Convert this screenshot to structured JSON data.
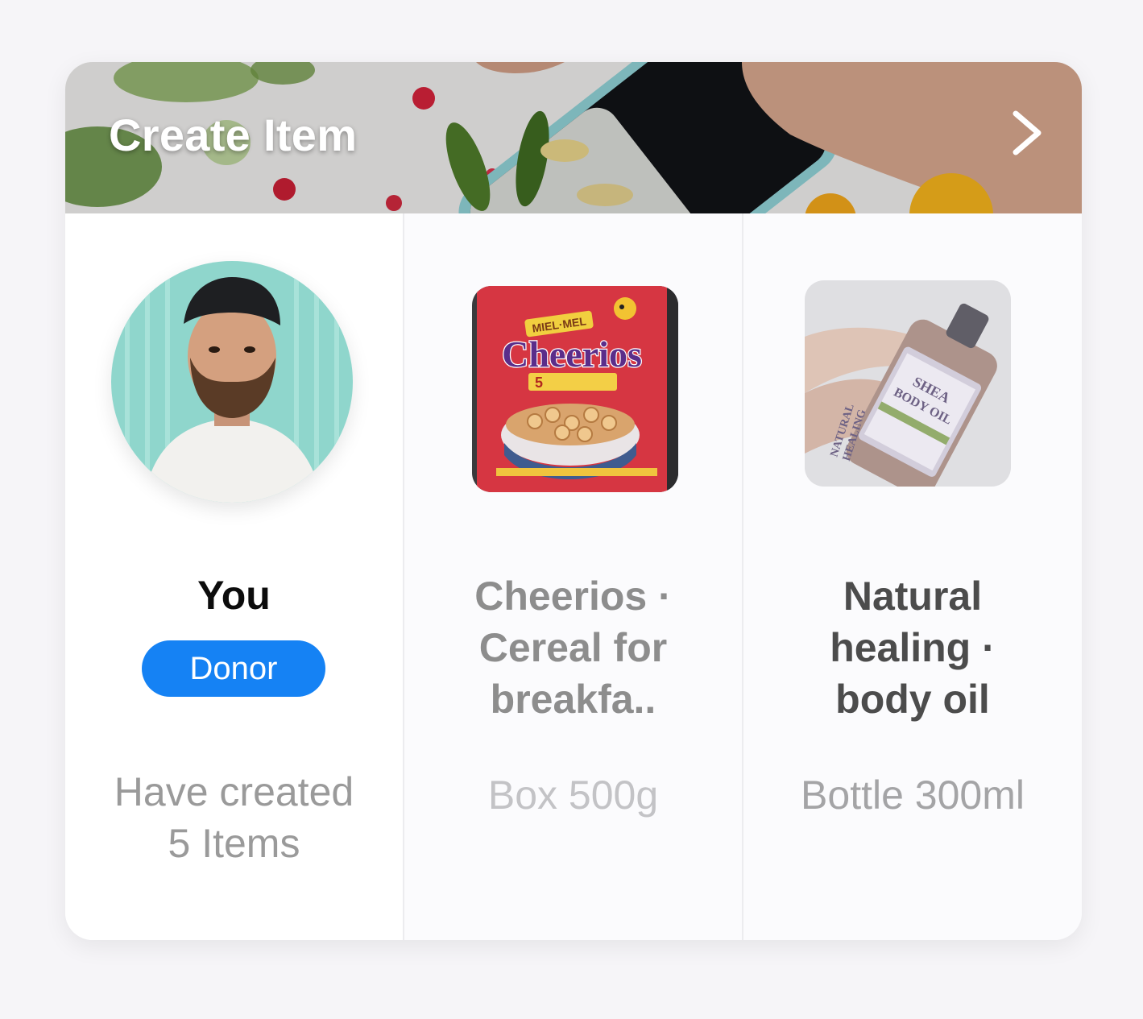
{
  "header": {
    "title": "Create Item",
    "action_icon": "chevron-right-icon"
  },
  "donor": {
    "name": "You",
    "role_badge": "Donor",
    "stat_line1": "Have created",
    "stat_line2": "5 Items"
  },
  "items": [
    {
      "title_line1": "Cheerios ·",
      "title_line2": "Cereal for",
      "title_line3": "breakfa..",
      "package": "Box 500g",
      "image_text": {
        "brand_top": "MIEL·MEL",
        "brand": "Cheerios",
        "badge": "5"
      }
    },
    {
      "title_line1": "Natural",
      "title_line2": "healing ·",
      "title_line3": "body oil",
      "package": "Bottle 300ml",
      "image_text": {
        "label1": "SHEA",
        "label2": "BODY OIL",
        "label3": "NATURAL",
        "label4": "HEALING"
      }
    }
  ],
  "colors": {
    "accent": "#1582f4",
    "background": "#f6f5f8",
    "card": "#ffffff"
  }
}
